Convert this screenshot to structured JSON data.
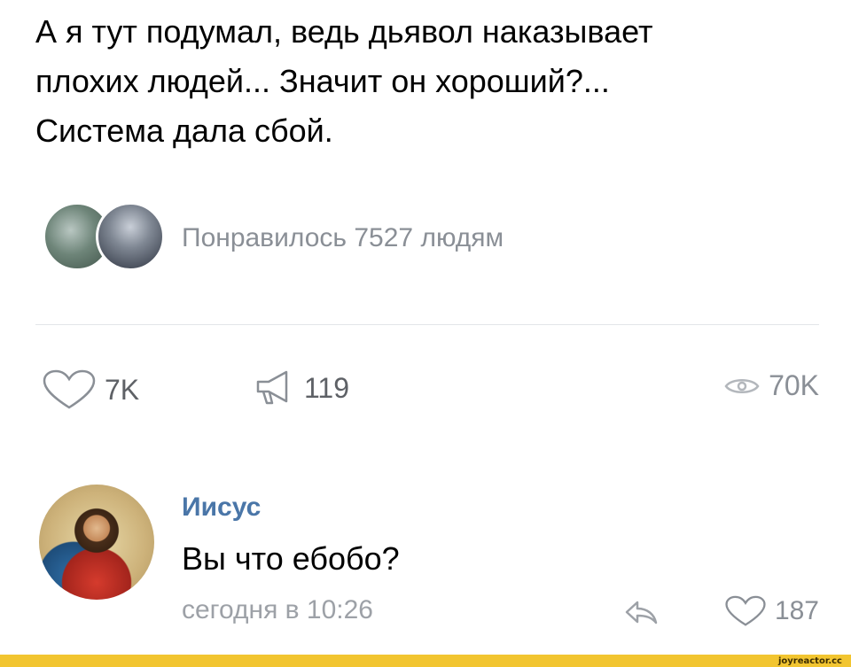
{
  "post": {
    "lines": [
      "А я тут подумал, ведь дьявол наказывает",
      "плохих людей... Значит он хороший?...",
      "Система дала сбой."
    ]
  },
  "likers": {
    "text": "Понравилось 7527 людям"
  },
  "actions": {
    "likes": "7K",
    "shares": "119",
    "views": "70K"
  },
  "comment": {
    "author": "Иисус",
    "text": "Вы что ебобо?",
    "time": "сегодня в 10:26",
    "likes": "187"
  },
  "footer": {
    "watermark": "joyreactor.cc"
  },
  "colors": {
    "link_blue": "#4a76a8",
    "muted_gray": "#8a8f96",
    "footer_yellow": "#f2c530"
  }
}
